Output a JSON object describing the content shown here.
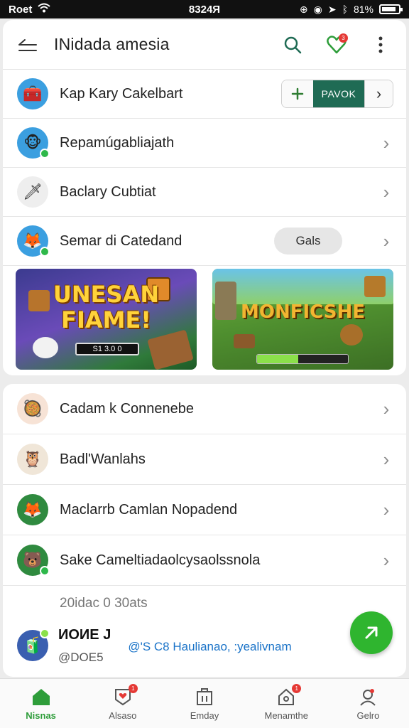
{
  "status_bar": {
    "carrier": "Roet",
    "time": "8324Я",
    "battery": "81%"
  },
  "header": {
    "title": "INidada amesia",
    "favorites_badge": "3"
  },
  "top_list": [
    {
      "label": "Kap Kary Cakelbart",
      "avatar_glyph": "🧰",
      "avatar_bg": "#3b9fe0"
    },
    {
      "label": "Repamúgabliajath",
      "avatar_glyph": "🐵",
      "avatar_bg": "#3b9fe0"
    },
    {
      "label": "Baclary Cubtiat",
      "avatar_glyph": "🗡",
      "avatar_bg": "#eeeeee"
    },
    {
      "label": "Semar di Catedand",
      "avatar_glyph": "🦊",
      "avatar_bg": "#3b9fe0",
      "pill_label": "Gals"
    }
  ],
  "segment": {
    "action_label": "PAVOK"
  },
  "banners": [
    {
      "title": "UNESAN FIAME!",
      "bar_text": "S1 3.0 0"
    },
    {
      "title": "MONFICSHE",
      "progress": 0.45
    }
  ],
  "bottom_list": [
    {
      "label": "Cadam k Connenebe",
      "avatar_glyph": "🥘",
      "avatar_bg": "#f7e3d6"
    },
    {
      "label": "Badl'Wanlahs",
      "avatar_glyph": "🦉",
      "avatar_bg": "#f0e6d8"
    },
    {
      "label": "Maclarrb Camlan Nopadend",
      "avatar_glyph": "🦊",
      "avatar_bg": "#2f8a3f"
    },
    {
      "label": "Sake Cameltiadaolcysaolssnola",
      "avatar_glyph": "🐻",
      "avatar_bg": "#2f8a3f"
    }
  ],
  "section_caption": "20idac 0 30ats",
  "last_item": {
    "name": "ИOИE J",
    "sub": "@DOE5",
    "link": "@'S C8 Haulianao, :yealivnam",
    "avatar_glyph": "🧃"
  },
  "nav": [
    {
      "label": "Nisnas",
      "active": true
    },
    {
      "label": "Alsaso",
      "badge": "1"
    },
    {
      "label": "Emday"
    },
    {
      "label": "Menamthe",
      "badge": "1"
    },
    {
      "label": "Gelro"
    }
  ],
  "colors": {
    "accent": "#2e9d3a",
    "segment_dark": "#1f6b54",
    "fab": "#2fb52f"
  }
}
